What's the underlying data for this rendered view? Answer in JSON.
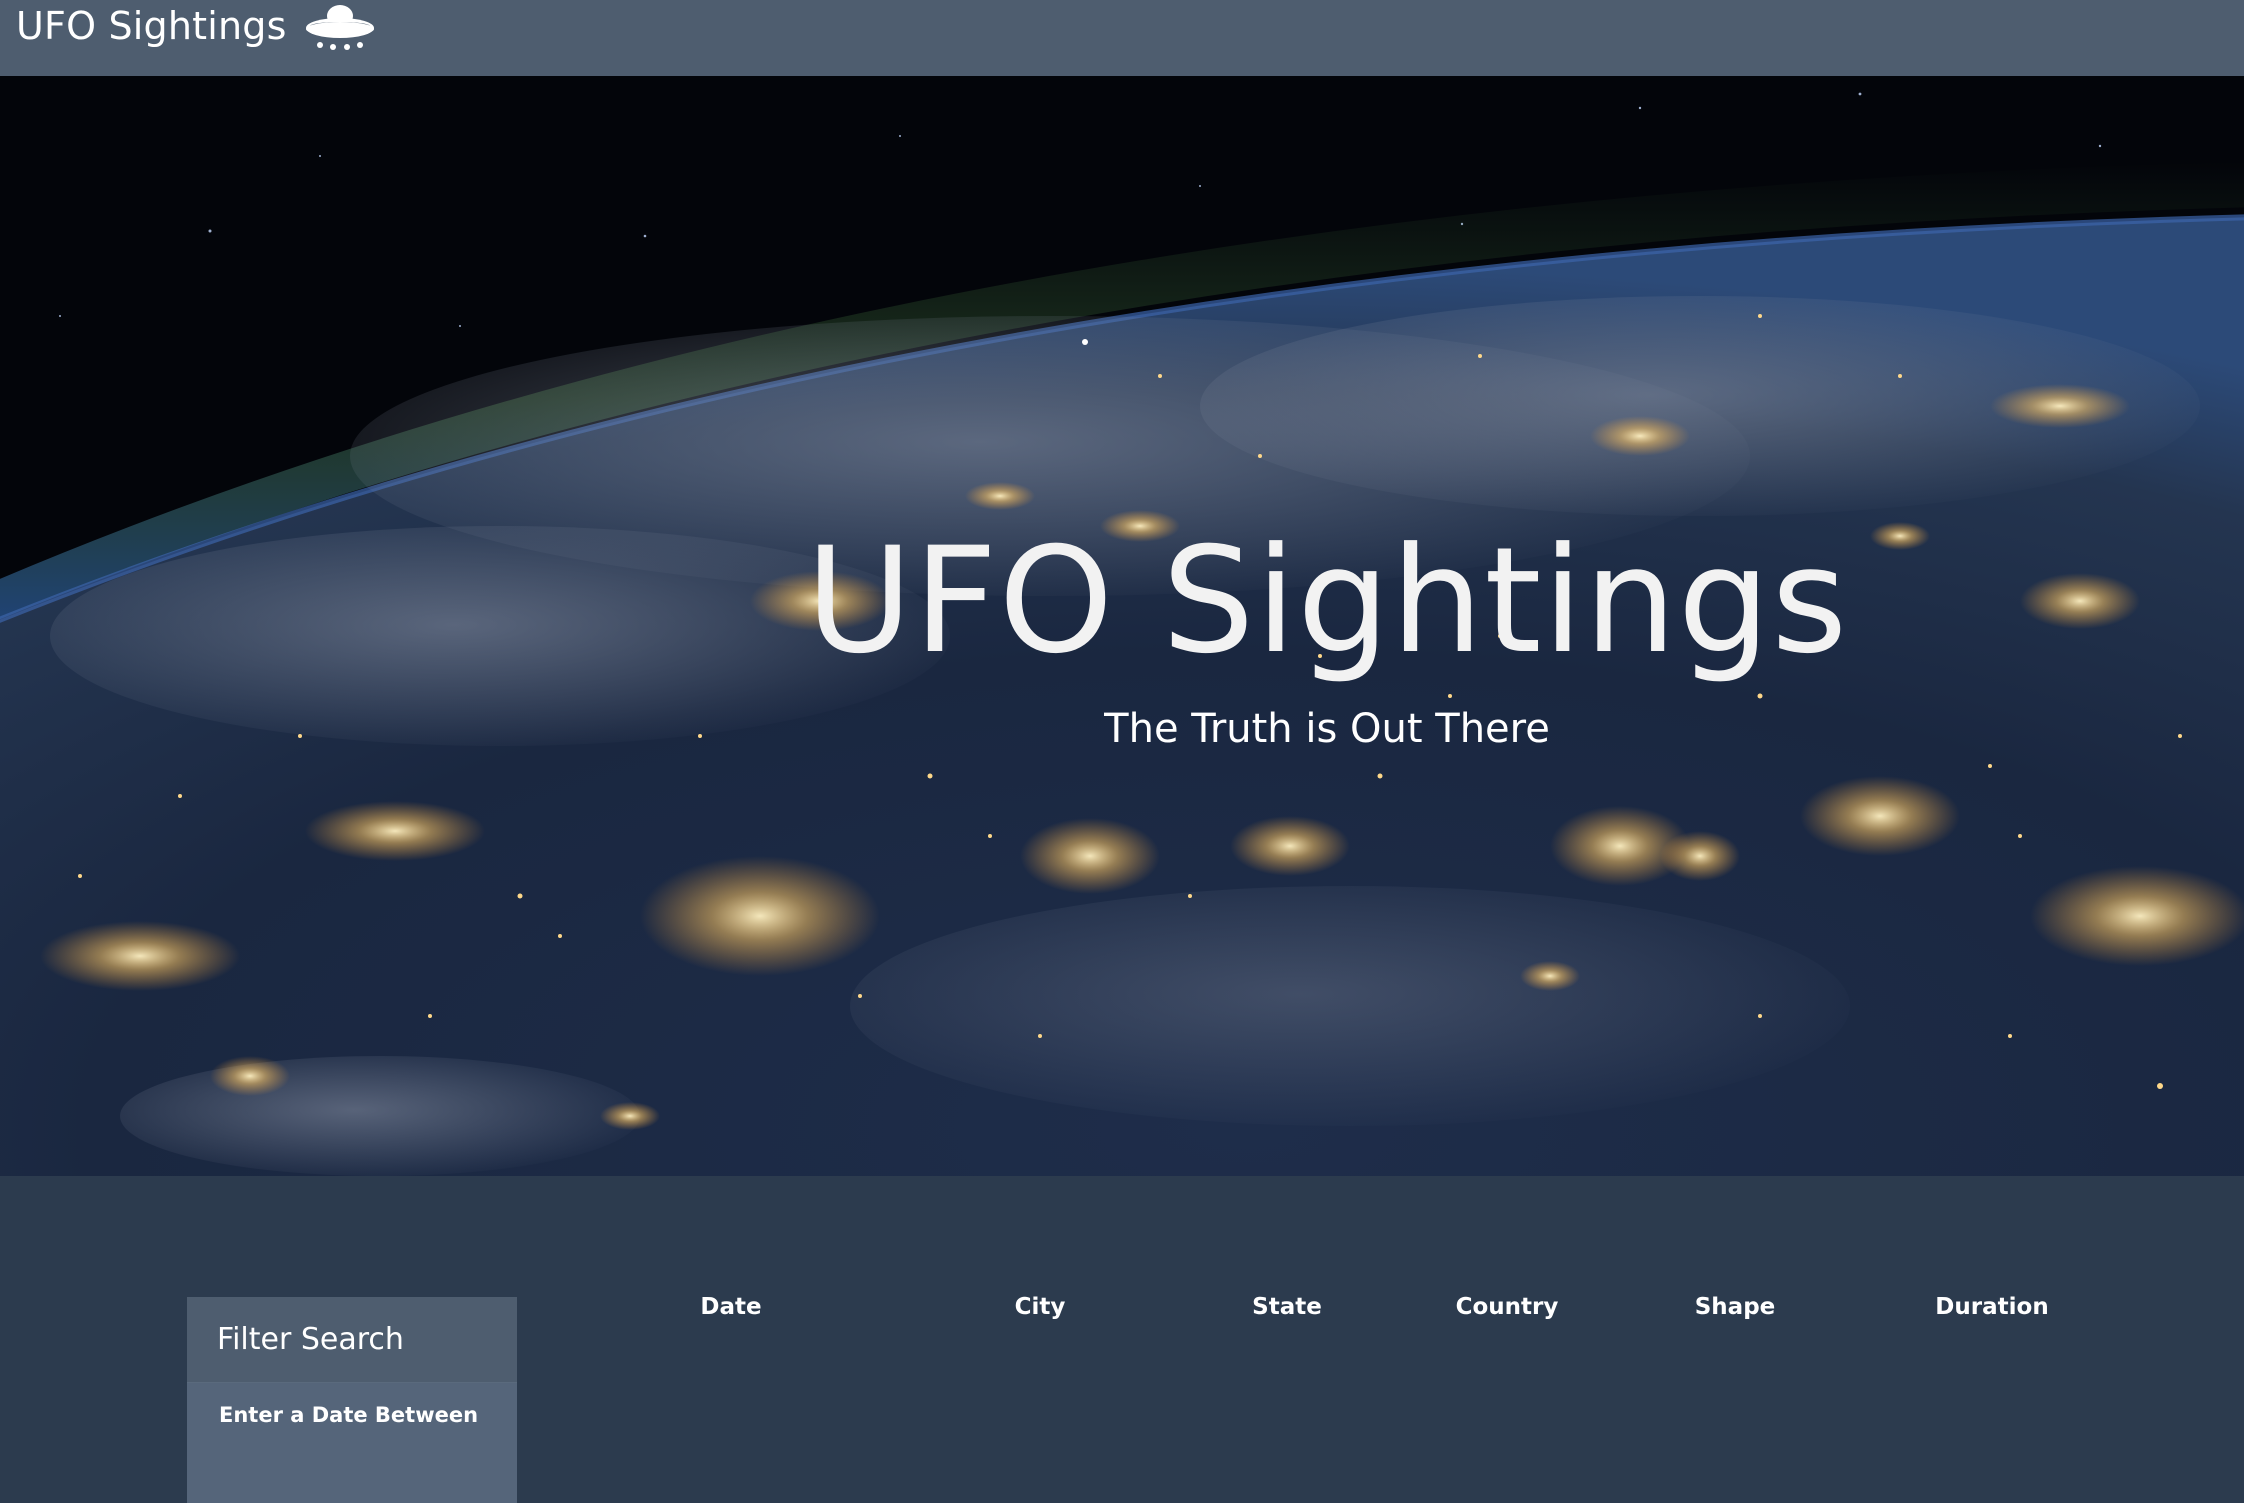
{
  "navbar": {
    "brand_text": "UFO Sightings",
    "brand_icon": "ufo-icon"
  },
  "hero": {
    "title": "UFO Sightings",
    "subtitle": "The Truth is Out There"
  },
  "filter": {
    "heading": "Filter Search",
    "date_label": "Enter a Date Between"
  },
  "table": {
    "headers": [
      "Date",
      "City",
      "State",
      "Country",
      "Shape",
      "Duration"
    ]
  },
  "colors": {
    "navbar": "#4e5d6f",
    "page_background": "#2c3b4e",
    "panel_heading": "#4e5d6f",
    "panel_body": "#55657a",
    "text": "#ffffff"
  }
}
